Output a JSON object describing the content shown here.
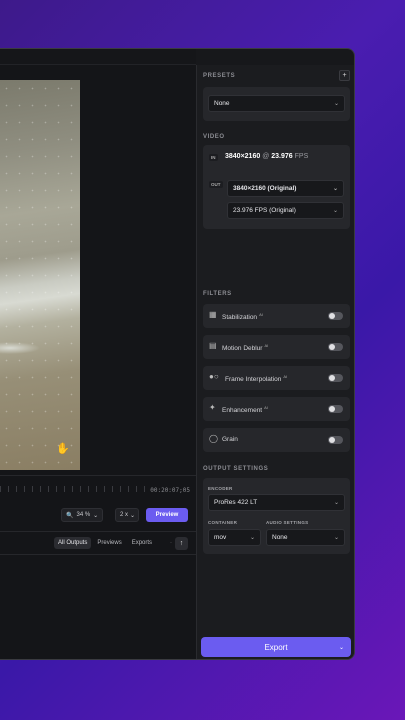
{
  "timeline": {
    "timecode": "00:20:07;05"
  },
  "viewer": {
    "zoom": "34 %",
    "fps_short": "2 x",
    "preview_label": "Preview"
  },
  "outputs_tabs": [
    "All Outputs",
    "Previews",
    "Exports"
  ],
  "presets": {
    "title": "PRESETS",
    "selected": "None"
  },
  "video": {
    "title": "VIDEO",
    "in_label": "IN",
    "out_label": "OUT",
    "in_resolution": "3840×2160",
    "in_at": "@",
    "in_fps": "23.976",
    "in_fps_unit": "FPS",
    "out_resolution": "3840×2160 (Original)",
    "out_fps": "23.976 FPS (Original)"
  },
  "filters": {
    "title": "FILTERS",
    "items": [
      {
        "label": "Stabilization",
        "ai": "AI",
        "icon": "stabilization-icon"
      },
      {
        "label": "Motion Deblur",
        "ai": "AI",
        "icon": "motion-deblur-icon"
      },
      {
        "label": "Frame Interpolation",
        "ai": "AI",
        "icon": "frame-interpolation-icon"
      },
      {
        "label": "Enhancement",
        "ai": "AI",
        "icon": "enhancement-icon"
      },
      {
        "label": "Grain",
        "ai": "",
        "icon": "grain-icon"
      }
    ]
  },
  "output_settings": {
    "title": "OUTPUT SETTINGS",
    "encoder_label": "ENCODER",
    "encoder": "ProRes 422 LT",
    "container_label": "CONTAINER",
    "container": "mov",
    "audio_label": "AUDIO SETTINGS",
    "audio": "None"
  },
  "export_label": "Export",
  "colors": {
    "accent": "#6b5cf0",
    "panel": "#26272b",
    "bg": "#1b1c1f"
  }
}
